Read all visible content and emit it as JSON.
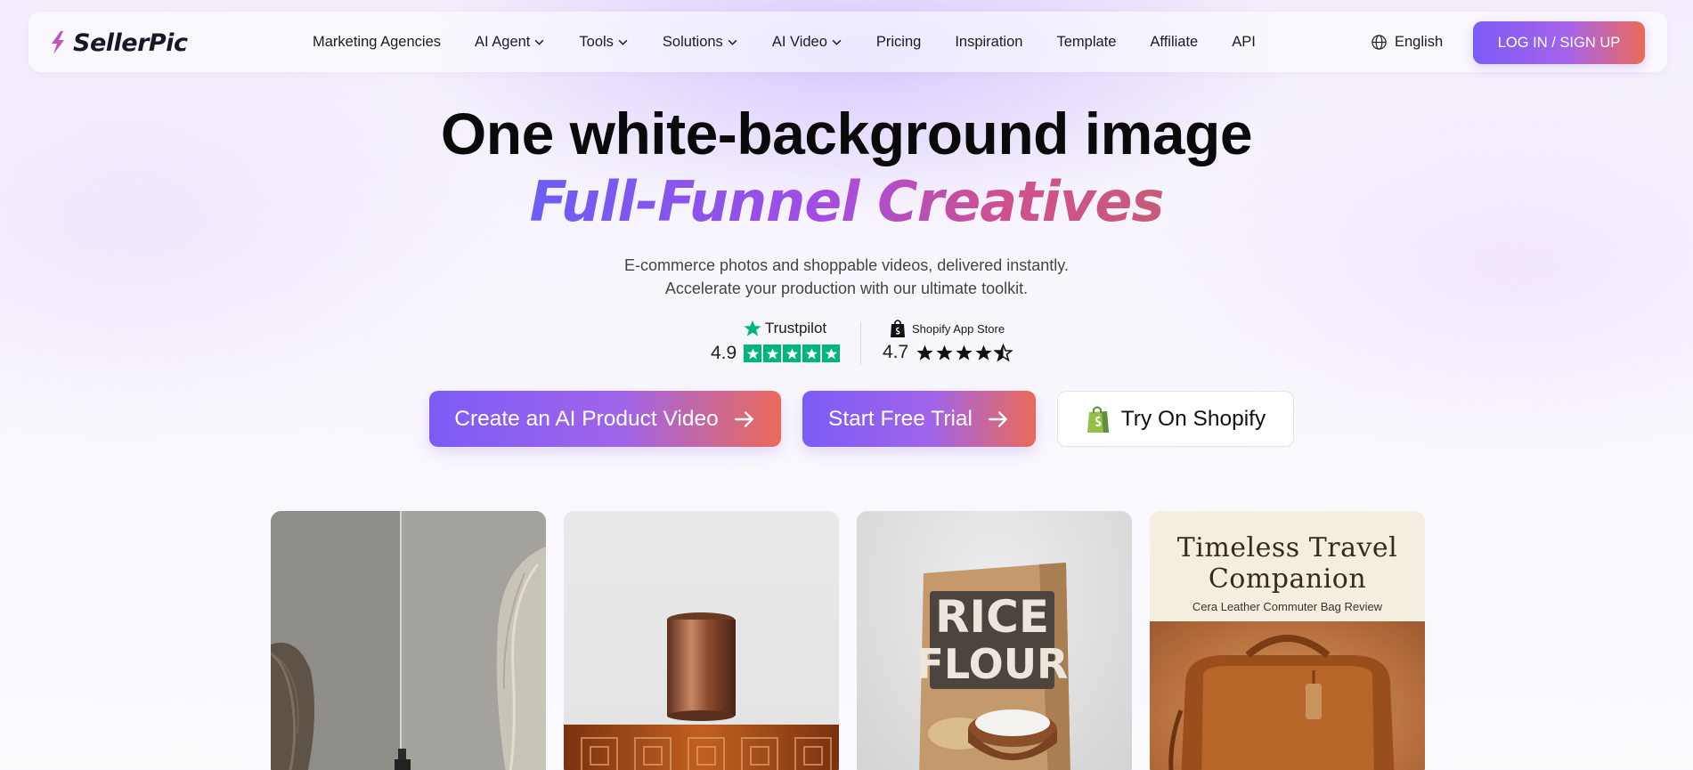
{
  "brand": {
    "name": "SellerPic"
  },
  "nav": {
    "items": [
      {
        "label": "Marketing Agencies",
        "dropdown": false
      },
      {
        "label": "AI Agent",
        "dropdown": true
      },
      {
        "label": "Tools",
        "dropdown": true
      },
      {
        "label": "Solutions",
        "dropdown": true
      },
      {
        "label": "AI Video",
        "dropdown": true
      },
      {
        "label": "Pricing",
        "dropdown": false
      },
      {
        "label": "Inspiration",
        "dropdown": false
      },
      {
        "label": "Template",
        "dropdown": false
      },
      {
        "label": "Affiliate",
        "dropdown": false
      },
      {
        "label": "API",
        "dropdown": false
      }
    ],
    "language": "English",
    "login_label": "LOG IN / SIGN UP"
  },
  "hero": {
    "title": "One white-background image",
    "subtitle": "Full-Funnel Creatives",
    "desc_line1": "E-commerce photos and shoppable videos, delivered instantly.",
    "desc_line2": "Accelerate your production with our ultimate toolkit."
  },
  "ratings": {
    "trustpilot": {
      "name": "Trustpilot",
      "score": "4.9",
      "stars": 5
    },
    "shopify": {
      "name": "Shopify App Store",
      "score": "4.7",
      "stars": 4.5
    }
  },
  "cta": {
    "video_label": "Create an AI Product Video",
    "trial_label": "Start Free Trial",
    "shopify_label": "Try On Shopify"
  },
  "cards": {
    "rice_line1": "RICE",
    "rice_line2": "FLOUR",
    "travel_title_line1": "Timeless Travel",
    "travel_title_line2": "Companion",
    "travel_subtitle": "Cera Leather Commuter Bag Review"
  },
  "colors": {
    "accent_start": "#7b5cf6",
    "accent_mid": "#a563ea",
    "accent_end": "#ec6a58",
    "trustpilot_green": "#00b67a",
    "shopify_green": "#95bf47"
  }
}
